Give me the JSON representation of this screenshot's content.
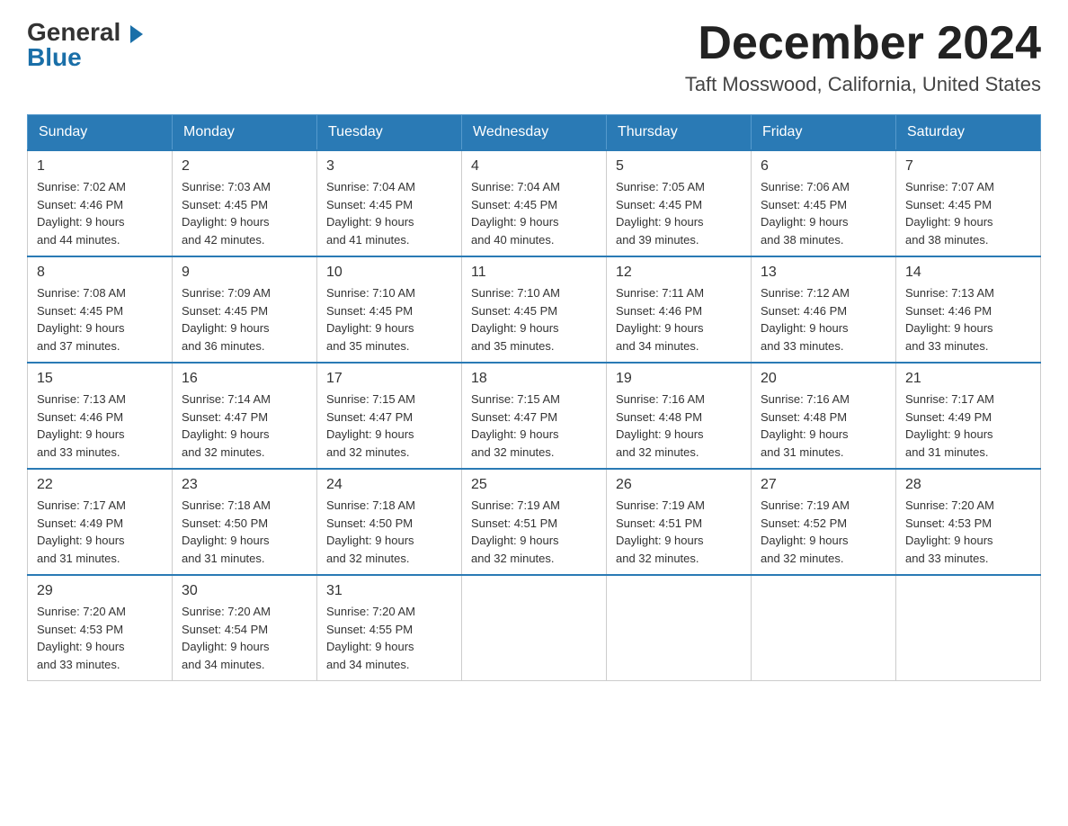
{
  "header": {
    "logo": {
      "general": "General",
      "blue": "Blue"
    },
    "title": "December 2024",
    "location": "Taft Mosswood, California, United States"
  },
  "weekdays": [
    "Sunday",
    "Monday",
    "Tuesday",
    "Wednesday",
    "Thursday",
    "Friday",
    "Saturday"
  ],
  "weeks": [
    [
      {
        "day": "1",
        "sunrise": "7:02 AM",
        "sunset": "4:46 PM",
        "daylight": "9 hours and 44 minutes."
      },
      {
        "day": "2",
        "sunrise": "7:03 AM",
        "sunset": "4:45 PM",
        "daylight": "9 hours and 42 minutes."
      },
      {
        "day": "3",
        "sunrise": "7:04 AM",
        "sunset": "4:45 PM",
        "daylight": "9 hours and 41 minutes."
      },
      {
        "day": "4",
        "sunrise": "7:04 AM",
        "sunset": "4:45 PM",
        "daylight": "9 hours and 40 minutes."
      },
      {
        "day": "5",
        "sunrise": "7:05 AM",
        "sunset": "4:45 PM",
        "daylight": "9 hours and 39 minutes."
      },
      {
        "day": "6",
        "sunrise": "7:06 AM",
        "sunset": "4:45 PM",
        "daylight": "9 hours and 38 minutes."
      },
      {
        "day": "7",
        "sunrise": "7:07 AM",
        "sunset": "4:45 PM",
        "daylight": "9 hours and 38 minutes."
      }
    ],
    [
      {
        "day": "8",
        "sunrise": "7:08 AM",
        "sunset": "4:45 PM",
        "daylight": "9 hours and 37 minutes."
      },
      {
        "day": "9",
        "sunrise": "7:09 AM",
        "sunset": "4:45 PM",
        "daylight": "9 hours and 36 minutes."
      },
      {
        "day": "10",
        "sunrise": "7:10 AM",
        "sunset": "4:45 PM",
        "daylight": "9 hours and 35 minutes."
      },
      {
        "day": "11",
        "sunrise": "7:10 AM",
        "sunset": "4:45 PM",
        "daylight": "9 hours and 35 minutes."
      },
      {
        "day": "12",
        "sunrise": "7:11 AM",
        "sunset": "4:46 PM",
        "daylight": "9 hours and 34 minutes."
      },
      {
        "day": "13",
        "sunrise": "7:12 AM",
        "sunset": "4:46 PM",
        "daylight": "9 hours and 33 minutes."
      },
      {
        "day": "14",
        "sunrise": "7:13 AM",
        "sunset": "4:46 PM",
        "daylight": "9 hours and 33 minutes."
      }
    ],
    [
      {
        "day": "15",
        "sunrise": "7:13 AM",
        "sunset": "4:46 PM",
        "daylight": "9 hours and 33 minutes."
      },
      {
        "day": "16",
        "sunrise": "7:14 AM",
        "sunset": "4:47 PM",
        "daylight": "9 hours and 32 minutes."
      },
      {
        "day": "17",
        "sunrise": "7:15 AM",
        "sunset": "4:47 PM",
        "daylight": "9 hours and 32 minutes."
      },
      {
        "day": "18",
        "sunrise": "7:15 AM",
        "sunset": "4:47 PM",
        "daylight": "9 hours and 32 minutes."
      },
      {
        "day": "19",
        "sunrise": "7:16 AM",
        "sunset": "4:48 PM",
        "daylight": "9 hours and 32 minutes."
      },
      {
        "day": "20",
        "sunrise": "7:16 AM",
        "sunset": "4:48 PM",
        "daylight": "9 hours and 31 minutes."
      },
      {
        "day": "21",
        "sunrise": "7:17 AM",
        "sunset": "4:49 PM",
        "daylight": "9 hours and 31 minutes."
      }
    ],
    [
      {
        "day": "22",
        "sunrise": "7:17 AM",
        "sunset": "4:49 PM",
        "daylight": "9 hours and 31 minutes."
      },
      {
        "day": "23",
        "sunrise": "7:18 AM",
        "sunset": "4:50 PM",
        "daylight": "9 hours and 31 minutes."
      },
      {
        "day": "24",
        "sunrise": "7:18 AM",
        "sunset": "4:50 PM",
        "daylight": "9 hours and 32 minutes."
      },
      {
        "day": "25",
        "sunrise": "7:19 AM",
        "sunset": "4:51 PM",
        "daylight": "9 hours and 32 minutes."
      },
      {
        "day": "26",
        "sunrise": "7:19 AM",
        "sunset": "4:51 PM",
        "daylight": "9 hours and 32 minutes."
      },
      {
        "day": "27",
        "sunrise": "7:19 AM",
        "sunset": "4:52 PM",
        "daylight": "9 hours and 32 minutes."
      },
      {
        "day": "28",
        "sunrise": "7:20 AM",
        "sunset": "4:53 PM",
        "daylight": "9 hours and 33 minutes."
      }
    ],
    [
      {
        "day": "29",
        "sunrise": "7:20 AM",
        "sunset": "4:53 PM",
        "daylight": "9 hours and 33 minutes."
      },
      {
        "day": "30",
        "sunrise": "7:20 AM",
        "sunset": "4:54 PM",
        "daylight": "9 hours and 34 minutes."
      },
      {
        "day": "31",
        "sunrise": "7:20 AM",
        "sunset": "4:55 PM",
        "daylight": "9 hours and 34 minutes."
      },
      null,
      null,
      null,
      null
    ]
  ],
  "labels": {
    "sunrise": "Sunrise:",
    "sunset": "Sunset:",
    "daylight": "Daylight:"
  }
}
